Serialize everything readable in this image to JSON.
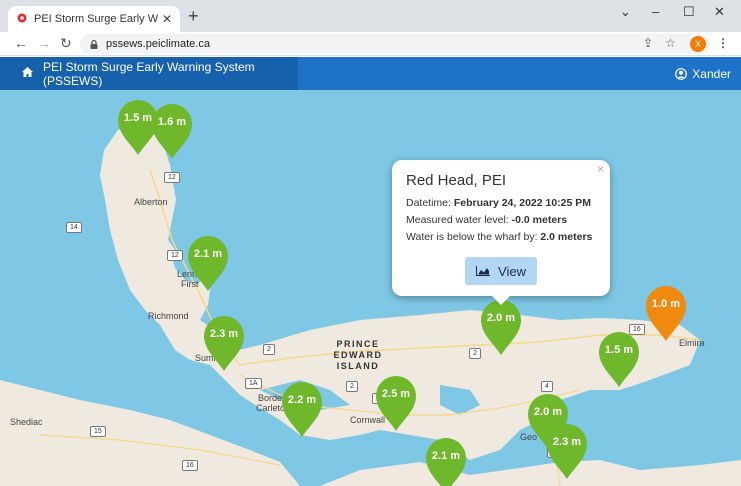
{
  "browser": {
    "tab_title": "PEI Storm Surge Early Warning Sy",
    "url": "pssews.peiclimate.ca",
    "profile_initial": "X"
  },
  "app": {
    "brand": "PEI Storm Surge Early Warning System (PSSEWS)",
    "user": "Xander"
  },
  "colors": {
    "green": "#6fb82b",
    "orange": "#f08a0f",
    "navbar": "#1e73c8"
  },
  "markers": [
    {
      "label": "1.5 m",
      "color": "green"
    },
    {
      "label": "1.6 m",
      "color": "green"
    },
    {
      "label": "2.1 m",
      "color": "green"
    },
    {
      "label": "2.3 m",
      "color": "green"
    },
    {
      "label": "2.0 m",
      "color": "green"
    },
    {
      "label": "1.0 m",
      "color": "orange"
    },
    {
      "label": "1.5 m",
      "color": "green"
    },
    {
      "label": "2.2 m",
      "color": "green"
    },
    {
      "label": "2.5 m",
      "color": "green"
    },
    {
      "label": "2.0 m",
      "color": "green"
    },
    {
      "label": "2.3 m",
      "color": "green"
    },
    {
      "label": "2.1 m",
      "color": "green"
    }
  ],
  "popup": {
    "title": "Red Head, PEI",
    "datetime_label": "Datetime:",
    "datetime_value": "February 24, 2022 10:25 PM",
    "water_label": "Measured water level:",
    "water_value": "-0.0 meters",
    "wharf_label": "Water is below the wharf by:",
    "wharf_value": "2.0 meters",
    "button": "View",
    "close": "×"
  },
  "places": {
    "alberton": "Alberton",
    "lennox": "Lennox",
    "first": "First",
    "richmond": "Richmond",
    "summerside": "Summ",
    "borden": "Borden-",
    "carleton": "Carleton",
    "shediac": "Shediac",
    "cornwall": "Cornwall",
    "elmira": "Elmira",
    "geo": "Geo",
    "pei_line1": "PRINCE",
    "pei_line2": "EDWARD",
    "pei_line3": "ISLAND"
  },
  "shields": [
    "12",
    "14",
    "12",
    "2",
    "1A",
    "2",
    "2",
    "15",
    "16",
    "16",
    "4",
    "17",
    "1"
  ]
}
